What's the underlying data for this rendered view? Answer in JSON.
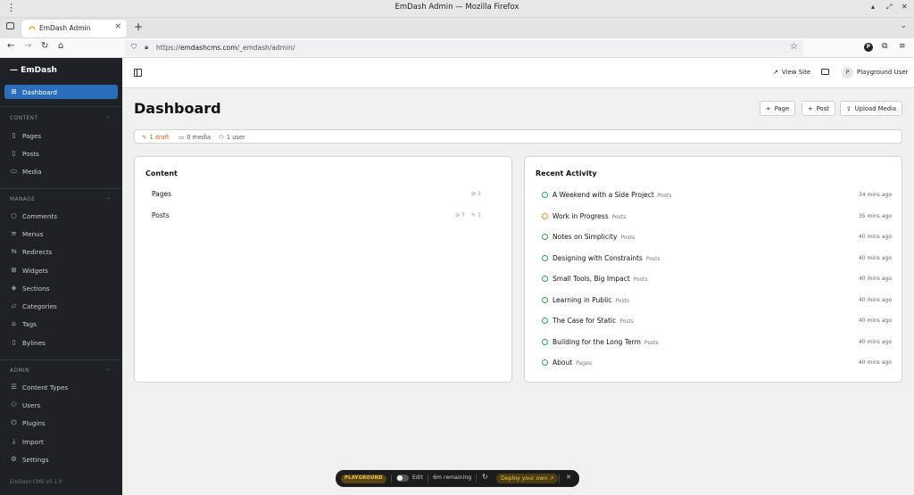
{
  "browser": {
    "window_title": "EmDash Admin — Mozilla Firefox",
    "tab_title": "EmDash Admin",
    "url_prefix": "https://",
    "url_host": "emdashcms.com",
    "url_path": "/_emdash/admin/"
  },
  "sidebar": {
    "brand": "— EmDash",
    "dashboard": "Dashboard",
    "sections": [
      {
        "title": "CONTENT",
        "items": [
          "Pages",
          "Posts",
          "Media"
        ]
      },
      {
        "title": "MANAGE",
        "items": [
          "Comments",
          "Menus",
          "Redirects",
          "Widgets",
          "Sections",
          "Categories",
          "Tags",
          "Bylines"
        ]
      },
      {
        "title": "ADMIN",
        "items": [
          "Content Types",
          "Users",
          "Plugins",
          "Import",
          "Settings"
        ]
      }
    ],
    "version": "EmDash CMS v0.1.0"
  },
  "header": {
    "view_site": "View Site",
    "user_initial": "P",
    "user_name": "Playground User"
  },
  "dashboard": {
    "title": "Dashboard",
    "buttons": {
      "page": "Page",
      "post": "Post",
      "upload": "Upload Media"
    },
    "stats": {
      "drafts": "1 draft",
      "media": "0 media",
      "users": "1 user"
    },
    "content_card": {
      "title": "Content",
      "rows": [
        {
          "label": "Pages",
          "published": "1",
          "drafts": ""
        },
        {
          "label": "Posts",
          "published": "7",
          "drafts": "1"
        }
      ]
    },
    "activity_card": {
      "title": "Recent Activity",
      "items": [
        {
          "title": "A Weekend with a Side Project",
          "type": "Posts",
          "time": "34 mins ago",
          "status": "published"
        },
        {
          "title": "Work in Progress",
          "type": "Posts",
          "time": "35 mins ago",
          "status": "draft"
        },
        {
          "title": "Notes on Simplicity",
          "type": "Posts",
          "time": "40 mins ago",
          "status": "published"
        },
        {
          "title": "Designing with Constraints",
          "type": "Posts",
          "time": "40 mins ago",
          "status": "published"
        },
        {
          "title": "Small Tools, Big Impact",
          "type": "Posts",
          "time": "40 mins ago",
          "status": "published"
        },
        {
          "title": "Learning in Public",
          "type": "Posts",
          "time": "40 mins ago",
          "status": "published"
        },
        {
          "title": "The Case for Static",
          "type": "Posts",
          "time": "40 mins ago",
          "status": "published"
        },
        {
          "title": "Building for the Long Term",
          "type": "Posts",
          "time": "40 mins ago",
          "status": "published"
        },
        {
          "title": "About",
          "type": "Pages",
          "time": "40 mins ago",
          "status": "published"
        }
      ]
    }
  },
  "playground": {
    "badge": "PLAYGROUND",
    "edit": "Edit",
    "remaining": "6m remaining",
    "deploy": "Deploy your own"
  }
}
